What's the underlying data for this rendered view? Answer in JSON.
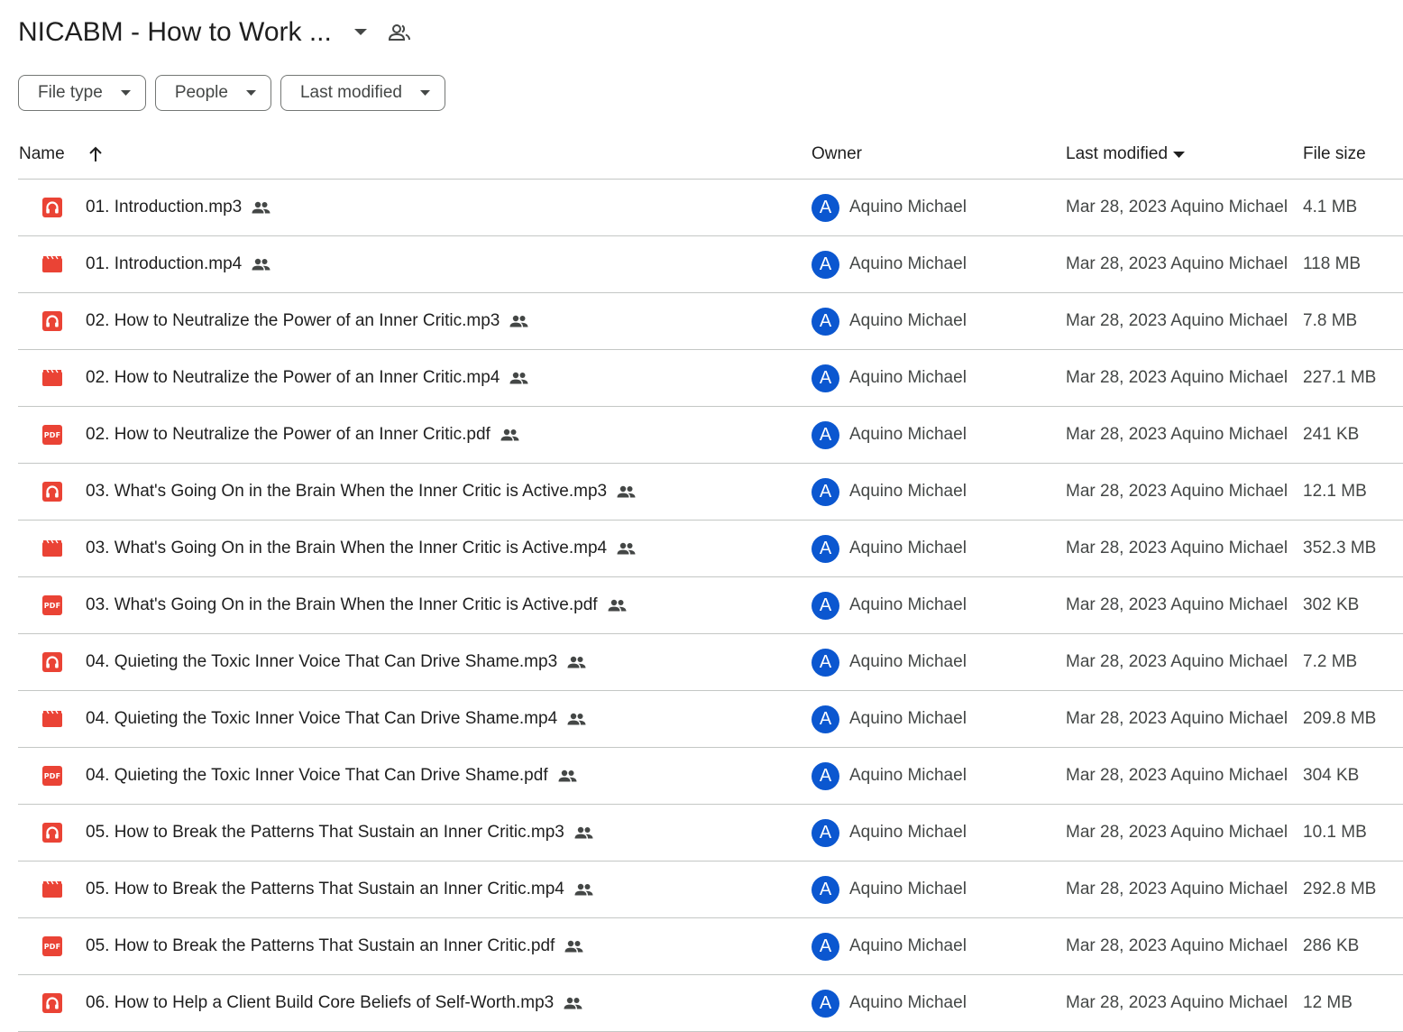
{
  "header": {
    "title": "NICABM - How to Work ..."
  },
  "filters": [
    {
      "label": "File type"
    },
    {
      "label": "People"
    },
    {
      "label": "Last modified"
    }
  ],
  "columns": {
    "name": "Name",
    "owner": "Owner",
    "last_modified": "Last modified",
    "file_size": "File size"
  },
  "accent_color": "#0b57d0",
  "file_icon_color": "#ea4335",
  "files": [
    {
      "name": "01. Introduction.mp3",
      "type": "audio",
      "owner_initial": "A",
      "owner": "Aquino Michael",
      "modified": "Mar 28, 2023 Aquino Michael",
      "size": "4.1 MB"
    },
    {
      "name": "01. Introduction.mp4",
      "type": "video",
      "owner_initial": "A",
      "owner": "Aquino Michael",
      "modified": "Mar 28, 2023 Aquino Michael",
      "size": "118 MB"
    },
    {
      "name": "02. How to Neutralize the Power of an Inner Critic.mp3",
      "type": "audio",
      "owner_initial": "A",
      "owner": "Aquino Michael",
      "modified": "Mar 28, 2023 Aquino Michael",
      "size": "7.8 MB"
    },
    {
      "name": "02. How to Neutralize the Power of an Inner Critic.mp4",
      "type": "video",
      "owner_initial": "A",
      "owner": "Aquino Michael",
      "modified": "Mar 28, 2023 Aquino Michael",
      "size": "227.1 MB"
    },
    {
      "name": "02. How to Neutralize the Power of an Inner Critic.pdf",
      "type": "pdf",
      "owner_initial": "A",
      "owner": "Aquino Michael",
      "modified": "Mar 28, 2023 Aquino Michael",
      "size": "241 KB"
    },
    {
      "name": "03. What's Going On in the Brain When the Inner Critic is Active.mp3",
      "type": "audio",
      "owner_initial": "A",
      "owner": "Aquino Michael",
      "modified": "Mar 28, 2023 Aquino Michael",
      "size": "12.1 MB"
    },
    {
      "name": "03. What's Going On in the Brain When the Inner Critic is Active.mp4",
      "type": "video",
      "owner_initial": "A",
      "owner": "Aquino Michael",
      "modified": "Mar 28, 2023 Aquino Michael",
      "size": "352.3 MB"
    },
    {
      "name": "03. What's Going On in the Brain When the Inner Critic is Active.pdf",
      "type": "pdf",
      "owner_initial": "A",
      "owner": "Aquino Michael",
      "modified": "Mar 28, 2023 Aquino Michael",
      "size": "302 KB"
    },
    {
      "name": "04. Quieting the Toxic Inner Voice That Can Drive Shame.mp3",
      "type": "audio",
      "owner_initial": "A",
      "owner": "Aquino Michael",
      "modified": "Mar 28, 2023 Aquino Michael",
      "size": "7.2 MB"
    },
    {
      "name": "04. Quieting the Toxic Inner Voice That Can Drive Shame.mp4",
      "type": "video",
      "owner_initial": "A",
      "owner": "Aquino Michael",
      "modified": "Mar 28, 2023 Aquino Michael",
      "size": "209.8 MB"
    },
    {
      "name": "04. Quieting the Toxic Inner Voice That Can Drive Shame.pdf",
      "type": "pdf",
      "owner_initial": "A",
      "owner": "Aquino Michael",
      "modified": "Mar 28, 2023 Aquino Michael",
      "size": "304 KB"
    },
    {
      "name": "05. How to Break the Patterns That Sustain an Inner Critic.mp3",
      "type": "audio",
      "owner_initial": "A",
      "owner": "Aquino Michael",
      "modified": "Mar 28, 2023 Aquino Michael",
      "size": "10.1 MB"
    },
    {
      "name": "05. How to Break the Patterns That Sustain an Inner Critic.mp4",
      "type": "video",
      "owner_initial": "A",
      "owner": "Aquino Michael",
      "modified": "Mar 28, 2023 Aquino Michael",
      "size": "292.8 MB"
    },
    {
      "name": "05. How to Break the Patterns That Sustain an Inner Critic.pdf",
      "type": "pdf",
      "owner_initial": "A",
      "owner": "Aquino Michael",
      "modified": "Mar 28, 2023 Aquino Michael",
      "size": "286 KB"
    },
    {
      "name": "06. How to Help a Client Build Core Beliefs of Self-Worth.mp3",
      "type": "audio",
      "owner_initial": "A",
      "owner": "Aquino Michael",
      "modified": "Mar 28, 2023 Aquino Michael",
      "size": "12 MB"
    }
  ]
}
